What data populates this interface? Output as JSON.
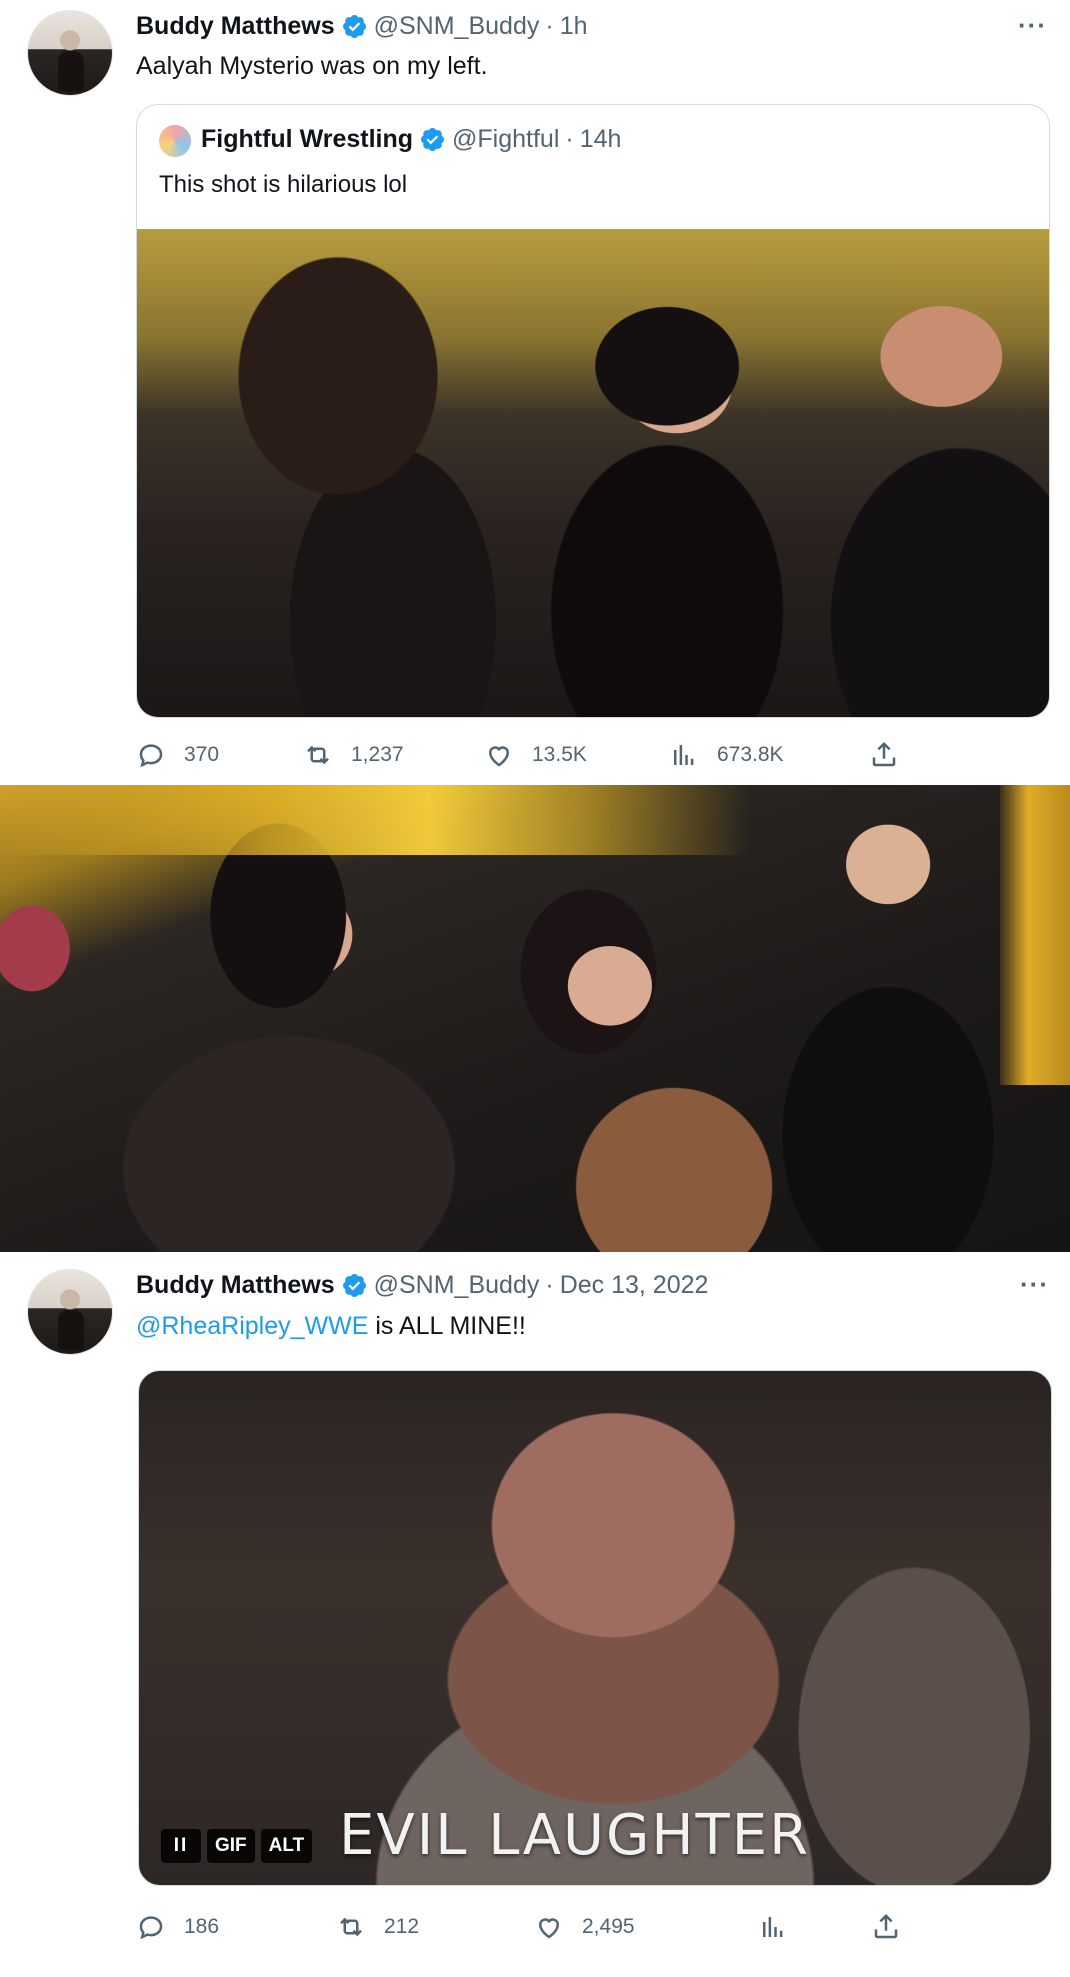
{
  "tweet1": {
    "name": "Buddy Matthews",
    "handle": "@SNM_Buddy",
    "separator": "·",
    "time": "1h",
    "more": "···",
    "text": "Aalyah Mysterio was on my left.",
    "quote": {
      "name": "Fightful Wrestling",
      "handle": "@Fightful",
      "separator": "·",
      "time": "14h",
      "text": "This shot is hilarious lol"
    },
    "actions": {
      "replies": "370",
      "retweets": "1,237",
      "likes": "13.5K",
      "views": "673.8K"
    }
  },
  "tweet2": {
    "name": "Buddy Matthews",
    "handle": "@SNM_Buddy",
    "separator": "·",
    "time": "Dec 13, 2022",
    "more": "···",
    "mention": "@RheaRipley_WWE",
    "text_rest": " is ALL MINE!!",
    "gif": {
      "caption": "EVIL LAUGHTER",
      "pause": "II",
      "gif_label": "GIF",
      "alt_label": "ALT"
    },
    "actions": {
      "replies": "186",
      "retweets": "212",
      "likes": "2,495"
    }
  },
  "colors": {
    "verified": "#1d9bf0",
    "secondary_text": "#536471",
    "link": "#1d9bf0"
  }
}
